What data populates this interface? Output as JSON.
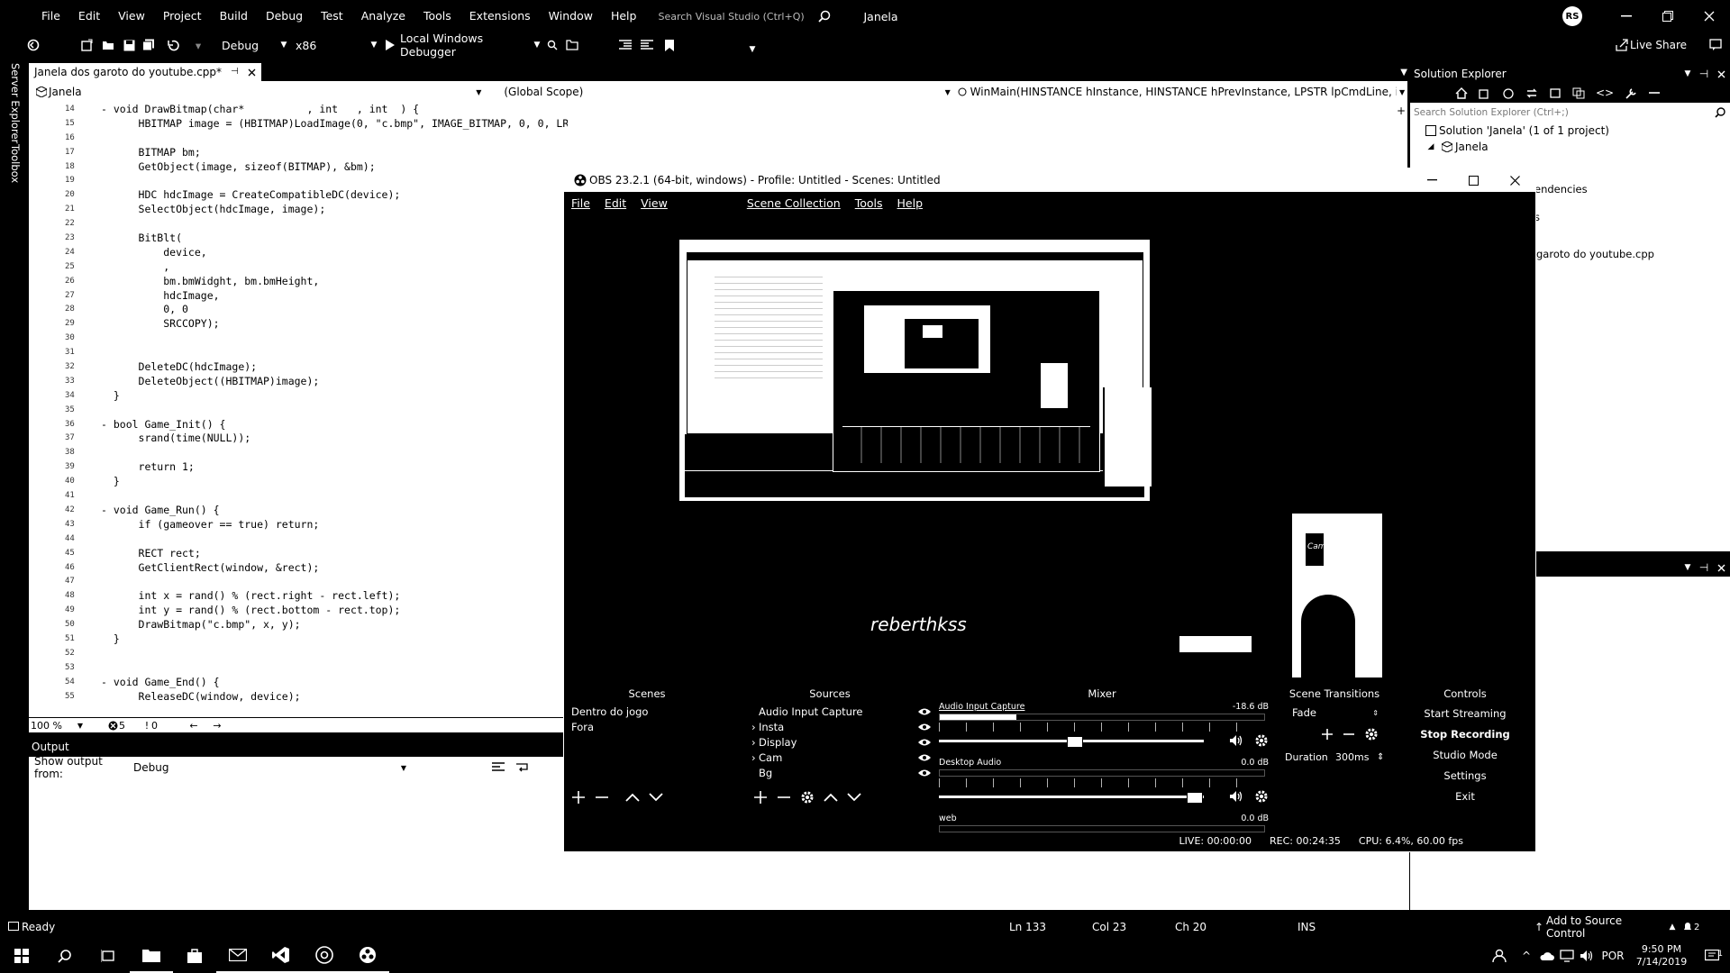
{
  "vs": {
    "menu": [
      "File",
      "Edit",
      "View",
      "Project",
      "Build",
      "Debug",
      "Test",
      "Analyze",
      "Tools",
      "Extensions",
      "Window",
      "Help"
    ],
    "search_placeholder": "Search Visual Studio (Ctrl+Q)",
    "solution_name": "Janela",
    "avatar": "RS",
    "live_share": "Live Share",
    "config": "Debug",
    "platform": "x86",
    "run_label": "Local Windows Debugger",
    "side_tabs": [
      "Server Explorer",
      "Toolbox"
    ],
    "editor_tab": "Janela dos garoto do youtube.cpp*",
    "nav_project": "Janela",
    "nav_scope": "(Global Scope)",
    "nav_function": "WinMain(HINSTANCE hInstance, HINSTANCE hPrevInstance, LPSTR lpCmdLine, int nCmc",
    "code": [
      {
        "n": "14",
        "t": "- void DrawBitmap(char*          , int   , int  ) {"
      },
      {
        "n": "15",
        "t": "      HBITMAP image = (HBITMAP)LoadImage(0, \"c.bmp\", IMAGE_BITMAP, 0, 0, LR_LOADFROMFILE);"
      },
      {
        "n": "16",
        "t": ""
      },
      {
        "n": "17",
        "t": "      BITMAP bm;"
      },
      {
        "n": "18",
        "t": "      GetObject(image, sizeof(BITMAP), &bm);"
      },
      {
        "n": "19",
        "t": ""
      },
      {
        "n": "20",
        "t": "      HDC hdcImage = CreateCompatibleDC(device);"
      },
      {
        "n": "21",
        "t": "      SelectObject(hdcImage, image);"
      },
      {
        "n": "22",
        "t": ""
      },
      {
        "n": "23",
        "t": "      BitBlt("
      },
      {
        "n": "24",
        "t": "          device,"
      },
      {
        "n": "25",
        "t": "          ,"
      },
      {
        "n": "26",
        "t": "          bm.bmWidght, bm.bmHeight,"
      },
      {
        "n": "27",
        "t": "          hdcImage,"
      },
      {
        "n": "28",
        "t": "          0, 0"
      },
      {
        "n": "29",
        "t": "          SRCCOPY);"
      },
      {
        "n": "30",
        "t": ""
      },
      {
        "n": "31",
        "t": ""
      },
      {
        "n": "32",
        "t": "      DeleteDC(hdcImage);"
      },
      {
        "n": "33",
        "t": "      DeleteObject((HBITMAP)image);"
      },
      {
        "n": "34",
        "t": "  }"
      },
      {
        "n": "35",
        "t": ""
      },
      {
        "n": "36",
        "t": "- bool Game_Init() {"
      },
      {
        "n": "37",
        "t": "      srand(time(NULL));"
      },
      {
        "n": "38",
        "t": ""
      },
      {
        "n": "39",
        "t": "      return 1;"
      },
      {
        "n": "40",
        "t": "  }"
      },
      {
        "n": "41",
        "t": ""
      },
      {
        "n": "42",
        "t": "- void Game_Run() {"
      },
      {
        "n": "43",
        "t": "      if (gameover == true) return;"
      },
      {
        "n": "44",
        "t": ""
      },
      {
        "n": "45",
        "t": "      RECT rect;"
      },
      {
        "n": "46",
        "t": "      GetClientRect(window, &rect);"
      },
      {
        "n": "47",
        "t": ""
      },
      {
        "n": "48",
        "t": "      int x = rand() % (rect.right - rect.left);"
      },
      {
        "n": "49",
        "t": "      int y = rand() % (rect.bottom - rect.top);"
      },
      {
        "n": "50",
        "t": "      DrawBitmap(\"c.bmp\", x, y);"
      },
      {
        "n": "51",
        "t": "  }"
      },
      {
        "n": "52",
        "t": ""
      },
      {
        "n": "53",
        "t": ""
      },
      {
        "n": "54",
        "t": "- void Game_End() {"
      },
      {
        "n": "55",
        "t": "      ReleaseDC(window, device);"
      }
    ],
    "zoom": "100 %",
    "errors": "5",
    "warnings": "0",
    "output_title": "Output",
    "output_from_label": "Show output from:",
    "output_from_value": "Debug",
    "solution_explorer": {
      "title": "Solution Explorer",
      "search_placeholder": "Search Solution Explorer (Ctrl+;)",
      "solution": "Solution 'Janela' (1 of 1 project)",
      "project": "Janela",
      "item_dependencies": "endencies",
      "item_s": "s",
      "item_cpp": "garoto do youtube.cpp"
    },
    "status": {
      "ready": "Ready",
      "ln": "Ln 133",
      "col": "Col 23",
      "ch": "Ch 20",
      "ins": "INS",
      "source_control": "Add to Source Control",
      "notifications": "2"
    }
  },
  "obs": {
    "title": "OBS 23.2.1 (64-bit, windows) - Profile: Untitled - Scenes: Untitled",
    "menu": [
      "File",
      "Edit",
      "View",
      "Scene Collection",
      "Tools",
      "Help"
    ],
    "overlay_text": "reberthkss",
    "cam_label": "Cam",
    "docks": {
      "scenes": "Scenes",
      "sources": "Sources",
      "mixer": "Mixer",
      "transitions": "Scene Transitions",
      "controls": "Controls"
    },
    "scenes": [
      "Dentro do jogo",
      "Fora"
    ],
    "sources": [
      {
        "name": "Audio Input Capture",
        "group": false
      },
      {
        "name": "Insta",
        "group": true
      },
      {
        "name": "Display",
        "group": true
      },
      {
        "name": "Cam",
        "group": true
      },
      {
        "name": "Bg",
        "group": false
      }
    ],
    "mixer": [
      {
        "name": "Audio Input Capture",
        "db": "-18.6 dB",
        "level": 0.5
      },
      {
        "name": "Desktop Audio",
        "db": "0.0 dB",
        "level": 0.97
      },
      {
        "name": "web",
        "db": "0.0 dB",
        "level": 0.97
      }
    ],
    "transition": "Fade",
    "duration_label": "Duration",
    "duration_value": "300ms",
    "controls": [
      "Start Streaming",
      "Stop Recording",
      "Studio Mode",
      "Settings",
      "Exit"
    ],
    "status": {
      "live": "LIVE: 00:00:00",
      "rec": "REC: 00:24:35",
      "cpu": "CPU: 6.4%, 60.00 fps"
    }
  },
  "taskbar": {
    "lang": "POR",
    "time": "9:50 PM",
    "date": "7/14/2019",
    "notif": "1"
  }
}
